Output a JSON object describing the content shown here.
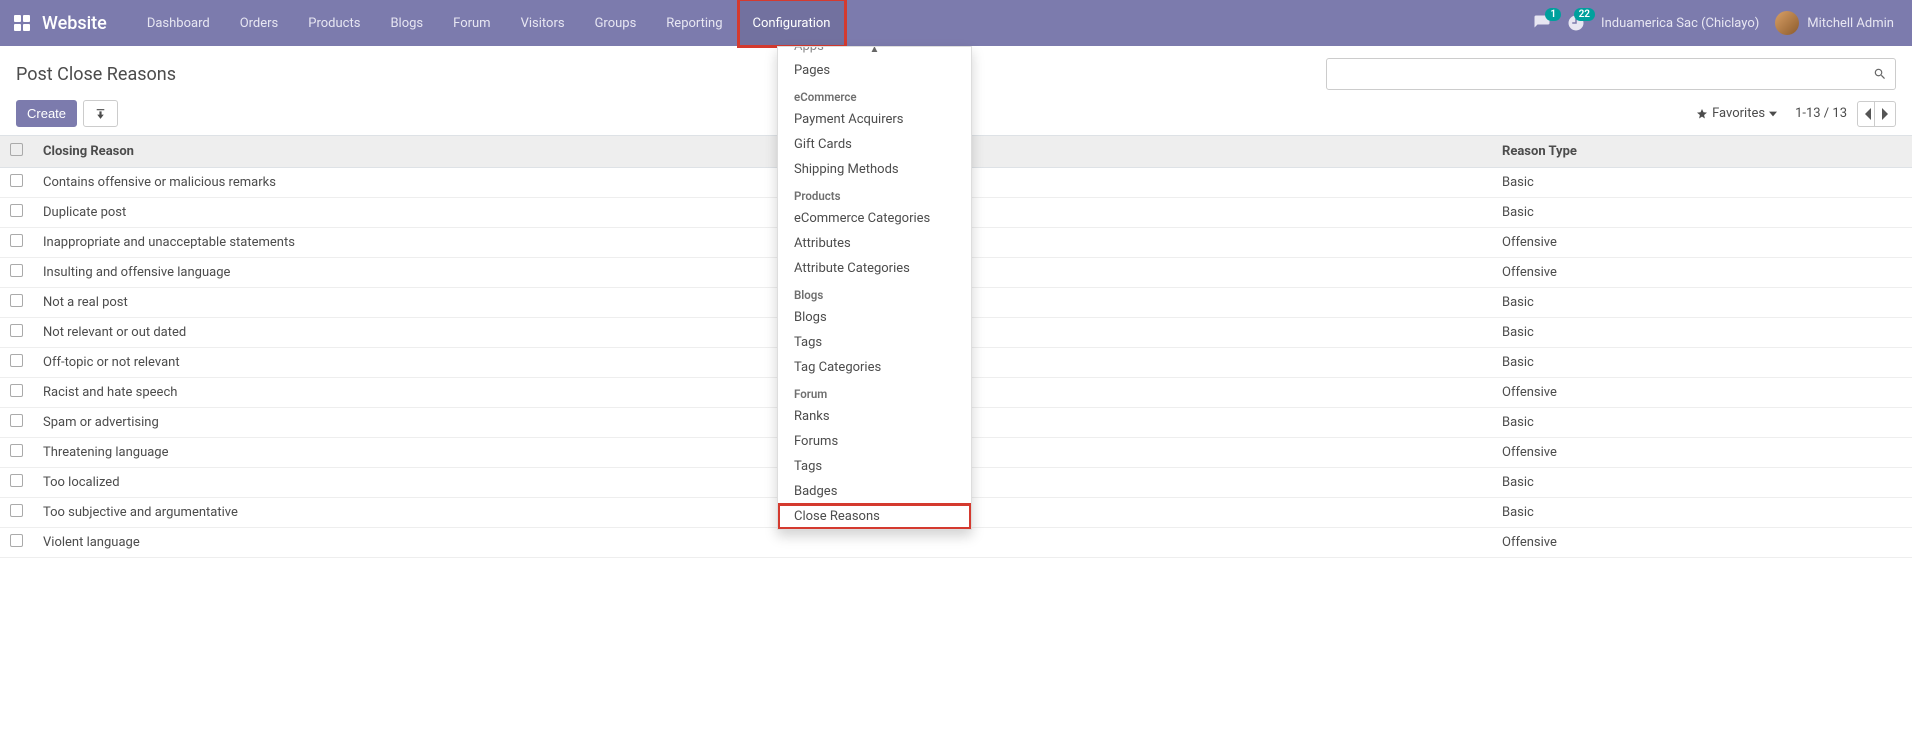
{
  "navbar": {
    "brand": "Website",
    "items": [
      {
        "label": "Dashboard"
      },
      {
        "label": "Orders"
      },
      {
        "label": "Products"
      },
      {
        "label": "Blogs"
      },
      {
        "label": "Forum"
      },
      {
        "label": "Visitors"
      },
      {
        "label": "Groups"
      },
      {
        "label": "Reporting"
      },
      {
        "label": "Configuration"
      }
    ],
    "msg_badge": "1",
    "activity_badge": "22",
    "company": "Induamerica Sac (Chiclayo)",
    "user": "Mitchell Admin"
  },
  "page": {
    "title": "Post Close Reasons",
    "create_label": "Create",
    "favorites_label": "Favorites",
    "pager": "1-13 / 13"
  },
  "table": {
    "col_reason": "Closing Reason",
    "col_type": "Reason Type",
    "rows": [
      {
        "reason": "Contains offensive or malicious remarks",
        "type": "Basic"
      },
      {
        "reason": "Duplicate post",
        "type": "Basic"
      },
      {
        "reason": "Inappropriate and unacceptable statements",
        "type": "Offensive"
      },
      {
        "reason": "Insulting and offensive language",
        "type": "Offensive"
      },
      {
        "reason": "Not a real post",
        "type": "Basic"
      },
      {
        "reason": "Not relevant or out dated",
        "type": "Basic"
      },
      {
        "reason": "Off-topic or not relevant",
        "type": "Basic"
      },
      {
        "reason": "Racist and hate speech",
        "type": "Offensive"
      },
      {
        "reason": "Spam or advertising",
        "type": "Basic"
      },
      {
        "reason": "Threatening language",
        "type": "Offensive"
      },
      {
        "reason": "Too localized",
        "type": "Basic"
      },
      {
        "reason": "Too subjective and argumentative",
        "type": "Basic"
      },
      {
        "reason": "Violent language",
        "type": "Offensive"
      }
    ]
  },
  "dropdown": {
    "truncated_top": "Apps",
    "website": {
      "items": [
        "Pages"
      ]
    },
    "ecommerce": {
      "header": "eCommerce",
      "items": [
        "Payment Acquirers",
        "Gift Cards",
        "Shipping Methods"
      ]
    },
    "products": {
      "header": "Products",
      "items": [
        "eCommerce Categories",
        "Attributes",
        "Attribute Categories"
      ]
    },
    "blogs": {
      "header": "Blogs",
      "items": [
        "Blogs",
        "Tags",
        "Tag Categories"
      ]
    },
    "forum": {
      "header": "Forum",
      "items": [
        "Ranks",
        "Forums",
        "Tags",
        "Badges",
        "Close Reasons"
      ]
    }
  }
}
